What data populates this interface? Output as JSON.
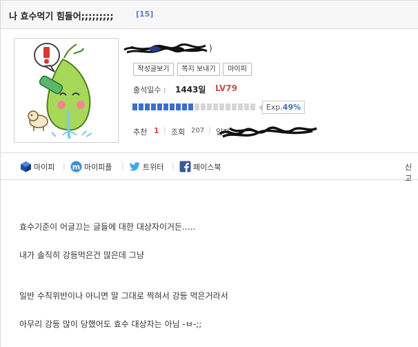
{
  "post": {
    "title": "나 효수먹기 힘들어;;;;;;;;;",
    "comment_count": "[15]"
  },
  "profile": {
    "nick_suffix": ")",
    "buttons": {
      "posts": "작성글보기",
      "note": "쪽지 보내기",
      "mypi": "마이피"
    },
    "attendance_label": "출석일수 :",
    "attendance_value": "1443일",
    "level": "LV79",
    "exp_label": "Exp.",
    "exp_percent": "49%",
    "exp_fraction": 0.49,
    "recommend_label": "추천",
    "recommend_value": "1",
    "views_label": "조회",
    "views_value": "207",
    "date_label": "일자"
  },
  "share": {
    "mypi": "마이피",
    "mypiple": "마이피플",
    "twitter": "트위터",
    "facebook": "페이스북",
    "report": "신고"
  },
  "content": {
    "lines": [
      "효수기준이 어글끄는 글들에 대한 대상자이거든.....",
      "내가 솔직히 강등먹은건 많은데 그냥",
      "일반 수칙위반이나 아니면 말 그대로 찍혀서 강등 먹은거라서",
      "아무리 강등 많이 당했어도 효수 대상자는 아님 -ㅂ-;;"
    ]
  },
  "colors": {
    "exp_filled": "#3d6fc7",
    "exp_empty": "#d5d5d5",
    "level": "#c0504d",
    "count": "#5b7fc7"
  }
}
